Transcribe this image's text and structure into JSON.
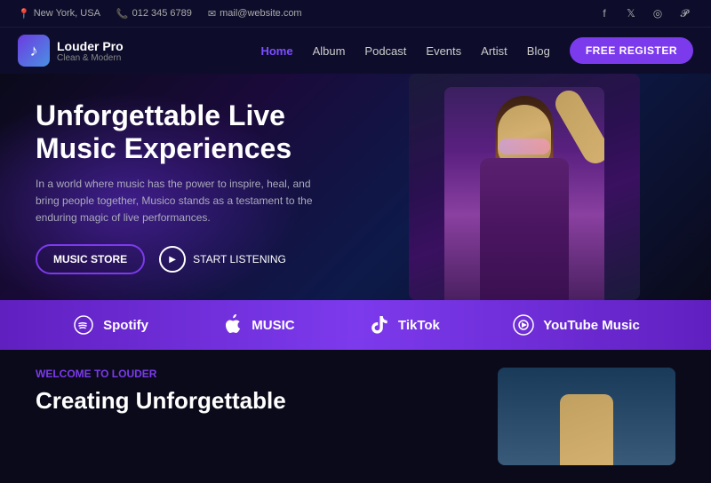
{
  "topbar": {
    "location": "New York, USA",
    "phone": "012 345 6789",
    "email": "mail@website.com",
    "social": [
      {
        "name": "facebook",
        "icon": "f",
        "url": "#"
      },
      {
        "name": "twitter",
        "icon": "t",
        "url": "#"
      },
      {
        "name": "instagram",
        "icon": "in",
        "url": "#"
      },
      {
        "name": "pinterest",
        "icon": "p",
        "url": "#"
      }
    ]
  },
  "navbar": {
    "logo_name": "Louder Pro",
    "logo_tagline": "Clean & Modern",
    "nav_items": [
      {
        "label": "Home",
        "active": true
      },
      {
        "label": "Album",
        "active": false
      },
      {
        "label": "Podcast",
        "active": false
      },
      {
        "label": "Events",
        "active": false
      },
      {
        "label": "Artist",
        "active": false
      },
      {
        "label": "Blog",
        "active": false
      }
    ],
    "cta_label": "FREE REGISTER"
  },
  "hero": {
    "title": "Unforgettable Live Music Experiences",
    "description": "In a world where music has the power to inspire, heal, and bring people together, Musico stands as a testament to the enduring magic of live performances.",
    "btn_store": "MUSIC STORE",
    "btn_listen": "START LISTENING"
  },
  "partners": [
    {
      "name": "Spotify",
      "icon": "spotify"
    },
    {
      "name": "MUSIC",
      "icon": "apple"
    },
    {
      "name": "TikTok",
      "icon": "tiktok"
    },
    {
      "name": "YouTube Music",
      "icon": "youtube"
    }
  ],
  "bottom": {
    "welcome_label": "WELCOME TO LOUDER",
    "title": "Creating Unforgettable"
  }
}
